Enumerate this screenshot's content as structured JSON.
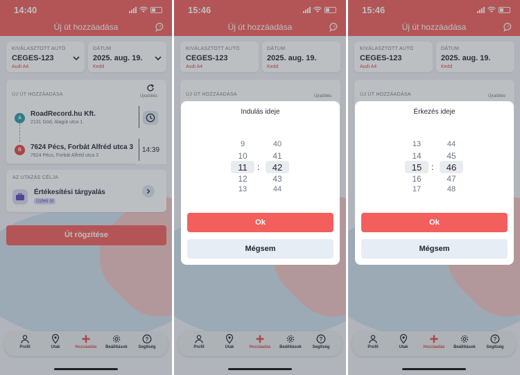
{
  "status_time_1": "14:40",
  "status_time_2": "15:46",
  "status_time_3": "15:46",
  "header_title": "Új út hozzáadása",
  "selected_car": {
    "label": "KIVÁLASZTOTT AUTÓ",
    "plate": "CEGES-123",
    "model": "Audi A4"
  },
  "date": {
    "label": "DÁTUM",
    "value": "2025. aug. 19.",
    "weekday": "Kedd"
  },
  "route_section": {
    "label": "ÚJ ÚT HOZZÁADÁSA",
    "reverse_label": "Újratöltés"
  },
  "start": {
    "letter": "A",
    "name": "RoadRecord.hu Kft.",
    "address": "2131 Göd, Alagút utca 1."
  },
  "end": {
    "letter": "B",
    "name": "7624 Pécs, Forbát Alfréd utca 3",
    "address": "7624 Pécs, Forbát Alfréd utca 3",
    "time": "14:39"
  },
  "purpose": {
    "label": "AZ UTAZÁS CÉLJA",
    "title": "Értékesítési tárgyalás",
    "tag": "Üzleti út"
  },
  "save_button": "Út rögzítése",
  "tabs": [
    {
      "label": "Profil",
      "icon": "person-icon"
    },
    {
      "label": "Utak",
      "icon": "map-pin-icon"
    },
    {
      "label": "Hozzáadás",
      "icon": "plus-icon"
    },
    {
      "label": "Beállítások",
      "icon": "gear-icon"
    },
    {
      "label": "Segítség",
      "icon": "question-icon"
    }
  ],
  "departure_picker": {
    "title": "Indulás ideje",
    "hours": [
      "9",
      "10",
      "11",
      "12",
      "13"
    ],
    "minutes": [
      "40",
      "41",
      "42",
      "43",
      "44"
    ],
    "ok": "Ok",
    "cancel": "Mégsem"
  },
  "arrival_picker": {
    "title": "Érkezés ideje",
    "hours": [
      "13",
      "14",
      "15",
      "16",
      "17"
    ],
    "minutes": [
      "44",
      "45",
      "46",
      "47",
      "48"
    ],
    "ok": "Ok",
    "cancel": "Mégsem"
  },
  "colors": {
    "accent": "#f25f5c",
    "accent_dark": "#e0463f",
    "purpose_icon": "#5b4ab5",
    "tag_bg": "#dcd8f5",
    "pin_a": "#2c9aa4",
    "pin_b": "#e0463f"
  }
}
